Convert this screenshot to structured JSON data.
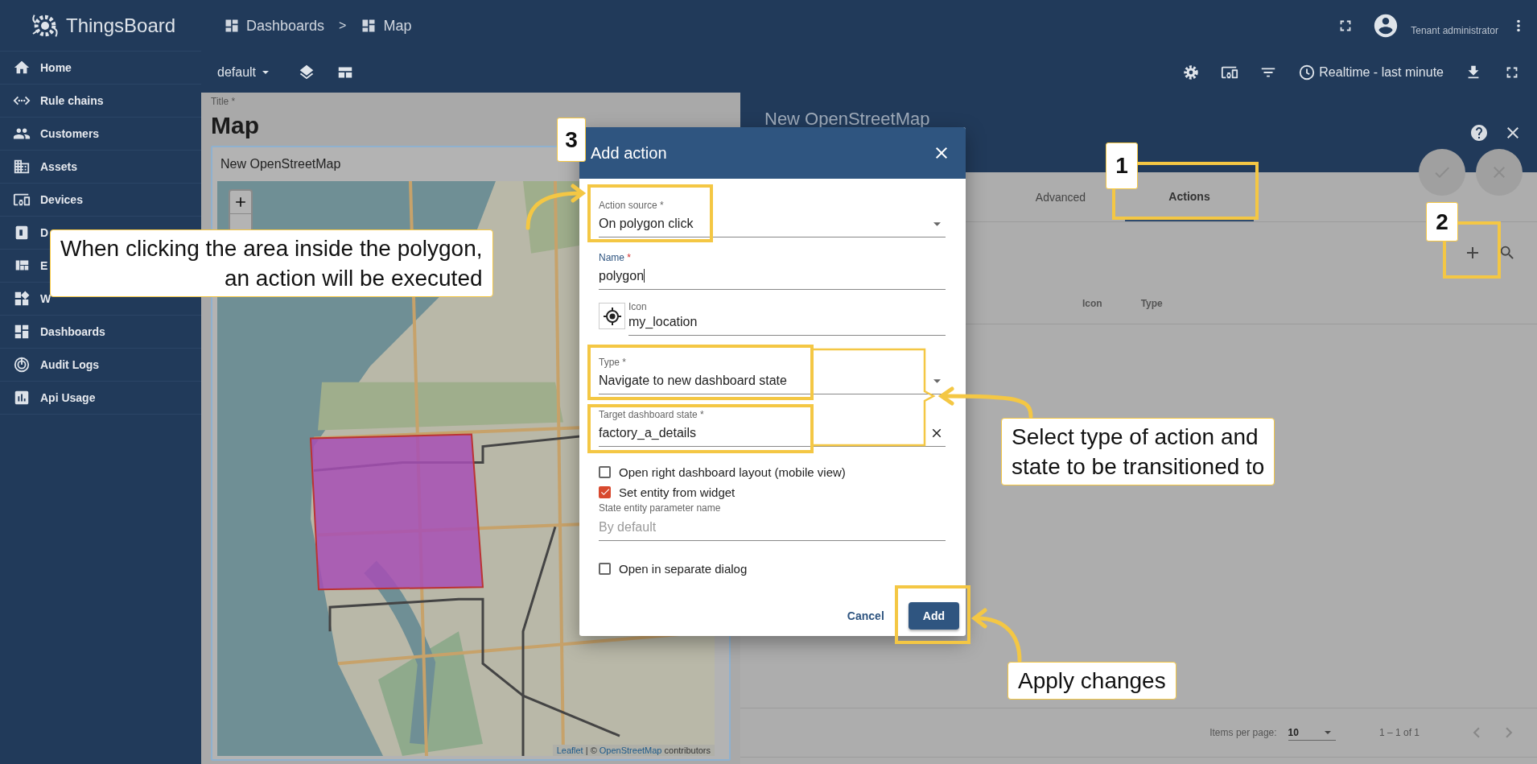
{
  "app": {
    "brand": "ThingsBoard"
  },
  "sidebar": {
    "items": [
      {
        "label": "Home"
      },
      {
        "label": "Rule chains"
      },
      {
        "label": "Customers"
      },
      {
        "label": "Assets"
      },
      {
        "label": "Devices"
      },
      {
        "label": "D"
      },
      {
        "label": "E"
      },
      {
        "label": "W"
      },
      {
        "label": "Dashboards"
      },
      {
        "label": "Audit Logs"
      },
      {
        "label": "Api Usage"
      }
    ]
  },
  "breadcrumb": {
    "items": [
      "Dashboards",
      "Map"
    ],
    "separator": ">"
  },
  "header": {
    "user_role": "Tenant administrator"
  },
  "toolbar": {
    "state": "default",
    "timewindow": "Realtime - last minute"
  },
  "dashboard": {
    "title_label": "Title *",
    "title": "Map",
    "widget": {
      "title": "New OpenStreetMap",
      "attribution": {
        "leaflet": "Leaflet",
        "separator": "| ©",
        "osm": "OpenStreetMap",
        "suffix": "contributors"
      }
    }
  },
  "widget_editor": {
    "title": "New OpenStreetMap",
    "tabs": [
      {
        "label": "Advanced",
        "selected": false
      },
      {
        "label": "Actions",
        "selected": true
      }
    ],
    "columns": [
      "Icon",
      "Type"
    ],
    "paginator": {
      "label": "Items per page:",
      "page_size": "10",
      "range": "1 – 1 of 1"
    }
  },
  "dialog": {
    "title": "Add action",
    "fields": [
      {
        "kind": "select",
        "label": "Action source",
        "mark": "*",
        "focused": false,
        "value": "On polygon click"
      },
      {
        "kind": "text",
        "label": "Name",
        "mark": "*",
        "focused": true,
        "value": "polygon"
      },
      {
        "kind": "icon",
        "label": "Icon",
        "focused": false,
        "value": "my_location"
      },
      {
        "kind": "select",
        "label": "Type",
        "mark": "*",
        "focused": false,
        "value": "Navigate to new dashboard state"
      },
      {
        "kind": "clearable",
        "label": "Target dashboard state",
        "mark": "*",
        "focused": false,
        "value": "factory_a_details"
      },
      {
        "kind": "checkbox",
        "label": "Open right dashboard layout (mobile view)",
        "checked": false
      },
      {
        "kind": "checkbox",
        "label": "Set entity from widget",
        "checked": true
      },
      {
        "kind": "input",
        "label": "State entity parameter name",
        "focused": false,
        "placeholder": "By default"
      },
      {
        "kind": "checkbox",
        "label": "Open in separate dialog",
        "checked": false
      }
    ],
    "buttons": [
      {
        "label": "Cancel",
        "kind": "text"
      },
      {
        "label": "Add",
        "kind": "primary"
      }
    ]
  },
  "annotations": {
    "badges": [
      {
        "label": "1"
      },
      {
        "label": "2"
      },
      {
        "label": "3"
      }
    ],
    "callouts": [
      {
        "text": "When clicking the area inside the polygon,\nan action will be executed"
      },
      {
        "text": "Select type of action and\nstate to be transitioned to"
      },
      {
        "text": "Apply changes"
      }
    ]
  }
}
